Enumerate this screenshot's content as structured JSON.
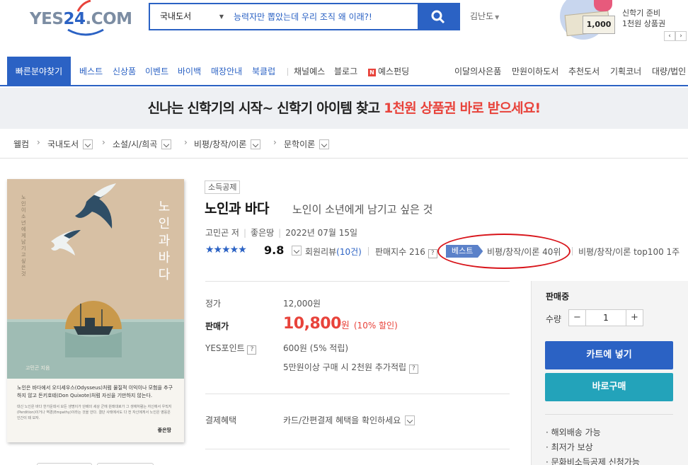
{
  "logo": {
    "text_a": "YES",
    "text_num": "24",
    "text_b": ".COM"
  },
  "search": {
    "category": "국내도서",
    "query": "능력자만 뽑았는데 우리 조직 왜 이래?!"
  },
  "user": {
    "name": "김난도"
  },
  "promo": {
    "line1": "신학기 준비",
    "line2": "1천원 상품권",
    "card_value": "1,000",
    "prev": "‹",
    "next": "›"
  },
  "nav": {
    "find": "빠른분야찾기",
    "items": [
      "베스트",
      "신상품",
      "이벤트",
      "바이백",
      "매장안내",
      "북클럽",
      "채널예스",
      "블로그",
      "예스펀딩"
    ],
    "n_badge": "N",
    "right_items": [
      "이달의사은품",
      "만원이하도서",
      "추천도서",
      "기획코너",
      "대량/법인"
    ]
  },
  "banner": {
    "text_before": "신나는 신학기의 시작~ 신학기 아이템 찾고 ",
    "text_highlight": "1천원 상품권 바로 받으세요!"
  },
  "breadcrumb": [
    "웰컴",
    "국내도서",
    "소설/시/희곡",
    "비평/창작/이론",
    "문학이론"
  ],
  "cover": {
    "vertical_title": "노인과바다",
    "vertical_subtitle": "노인이 소년에게 남기고 싶은 것",
    "author": "고민곤 지음",
    "blurb_main": "노인은 바다에서 오디세우스(Odysseus)처럼 물질적 이익이나 모험을 추구하지 않고 돈키호테(Don Quixote)처럼 자신을 기만하지 않는다.",
    "blurb_small": "대신 노인은 바다 한가운데서 모든 생명이가 단배의 세상 군에 원래대로가 그 생애처럼는 자신에서 우직지(Perdition)이거나 역경(Empathy)이라는 것을 안다. 결단 사태에서도 다 전 자신에게서 노인은 영웅은 인간이 돼 보자.",
    "publisher": "좋은땅"
  },
  "book": {
    "tag": "소득공제",
    "title": "노인과 바다",
    "subtitle": "노인이 소년에게 남기고 싶은 것",
    "author": "고민곤 저",
    "publisher": "좋은땅",
    "date": "2022년 07월 15일",
    "stars": "★★★★★",
    "score": "9.8",
    "review_label": "회원리뷰",
    "review_count": "(10건)",
    "sales_index": "판매지수 216",
    "best_badge": "베스트",
    "best_rank": "비평/창작/이론 40위",
    "top100": "비평/창작/이론 top100 1주",
    "q": "?"
  },
  "price": {
    "list_label": "정가",
    "list_value": "12,000원",
    "sale_label": "판매가",
    "sale_value": "10,800",
    "sale_unit": "원",
    "sale_pct": "(10% 할인)",
    "points_label": "YES포인트",
    "points_value": "600원 (5% 적립)",
    "points_extra": "5만원이상 구매 시 2천원 추가적립",
    "pay_label": "결제혜택",
    "pay_value": "카드/간편결제 혜택을 확인하세요"
  },
  "panel": {
    "status": "판매중",
    "qty_label": "수량",
    "qty": "1",
    "minus": "−",
    "plus": "+",
    "cart": "카트에 넣기",
    "buy": "바로구매",
    "perks": [
      "· 해외배송 가능",
      "· 최저가 보상",
      "· 문화비소득공제 신청가능"
    ]
  },
  "colors": {
    "brand": "#2b62c4",
    "sale": "#e8433b",
    "buy": "#23a3ba",
    "annotation": "#d8141a"
  }
}
